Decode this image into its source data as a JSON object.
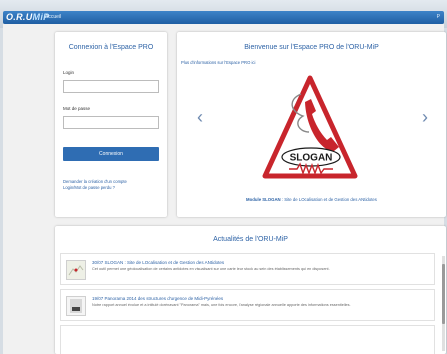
{
  "header": {
    "logo_main": "O.R.U",
    "logo_accent": "MiP",
    "home_label": "Accueil",
    "right_label": "P"
  },
  "login": {
    "title": "Connexion à l'Espace PRO",
    "login_label": "Login",
    "login_value": "",
    "password_label": "Mot de passe",
    "password_value": "",
    "submit_label": "Connexion",
    "request_account_link": "Demander la création d'un compte",
    "lost_password_link": "Login/Mot de passe perdu ?"
  },
  "welcome": {
    "title": "Bienvenue sur l'Espace PRO de l'ORU-MiP",
    "info_link": "Plus d'informations sur l'Espace PRO ici",
    "slide_logo_text": "SLOGAN",
    "caption_bold": "Module SLOGAN",
    "caption_rest": " : Site de LOcalisation et de Gestion des ANtidotes",
    "prev_icon": "chevron-left-icon",
    "next_icon": "chevron-right-icon"
  },
  "news": {
    "title": "Actualités de l'ORU-MiP",
    "items": [
      {
        "headline": "30/07 SLOGAN : Site de LOcalisation et de Gestion des ANtidotes",
        "text": "Cet outil permet une géolocalisation de certains antidotes en visualisant sur une carte leur stock au sein des établissements qui en disposent."
      },
      {
        "headline": "19/07 Panorama 2014 des structures d'urgence de Midi-Pyrénées",
        "text": "Notre rapport annuel évolue et a intitulé dorénavant \"Panorama\" mais, une fois encore, l'analyse régionale annuelle apporte des informations essentielles."
      },
      {
        "headline": "",
        "text": ""
      }
    ]
  },
  "colors": {
    "brand_blue": "#2f6db3",
    "nav_blue": "#1f5ea3",
    "slogan_red": "#c8252c"
  }
}
